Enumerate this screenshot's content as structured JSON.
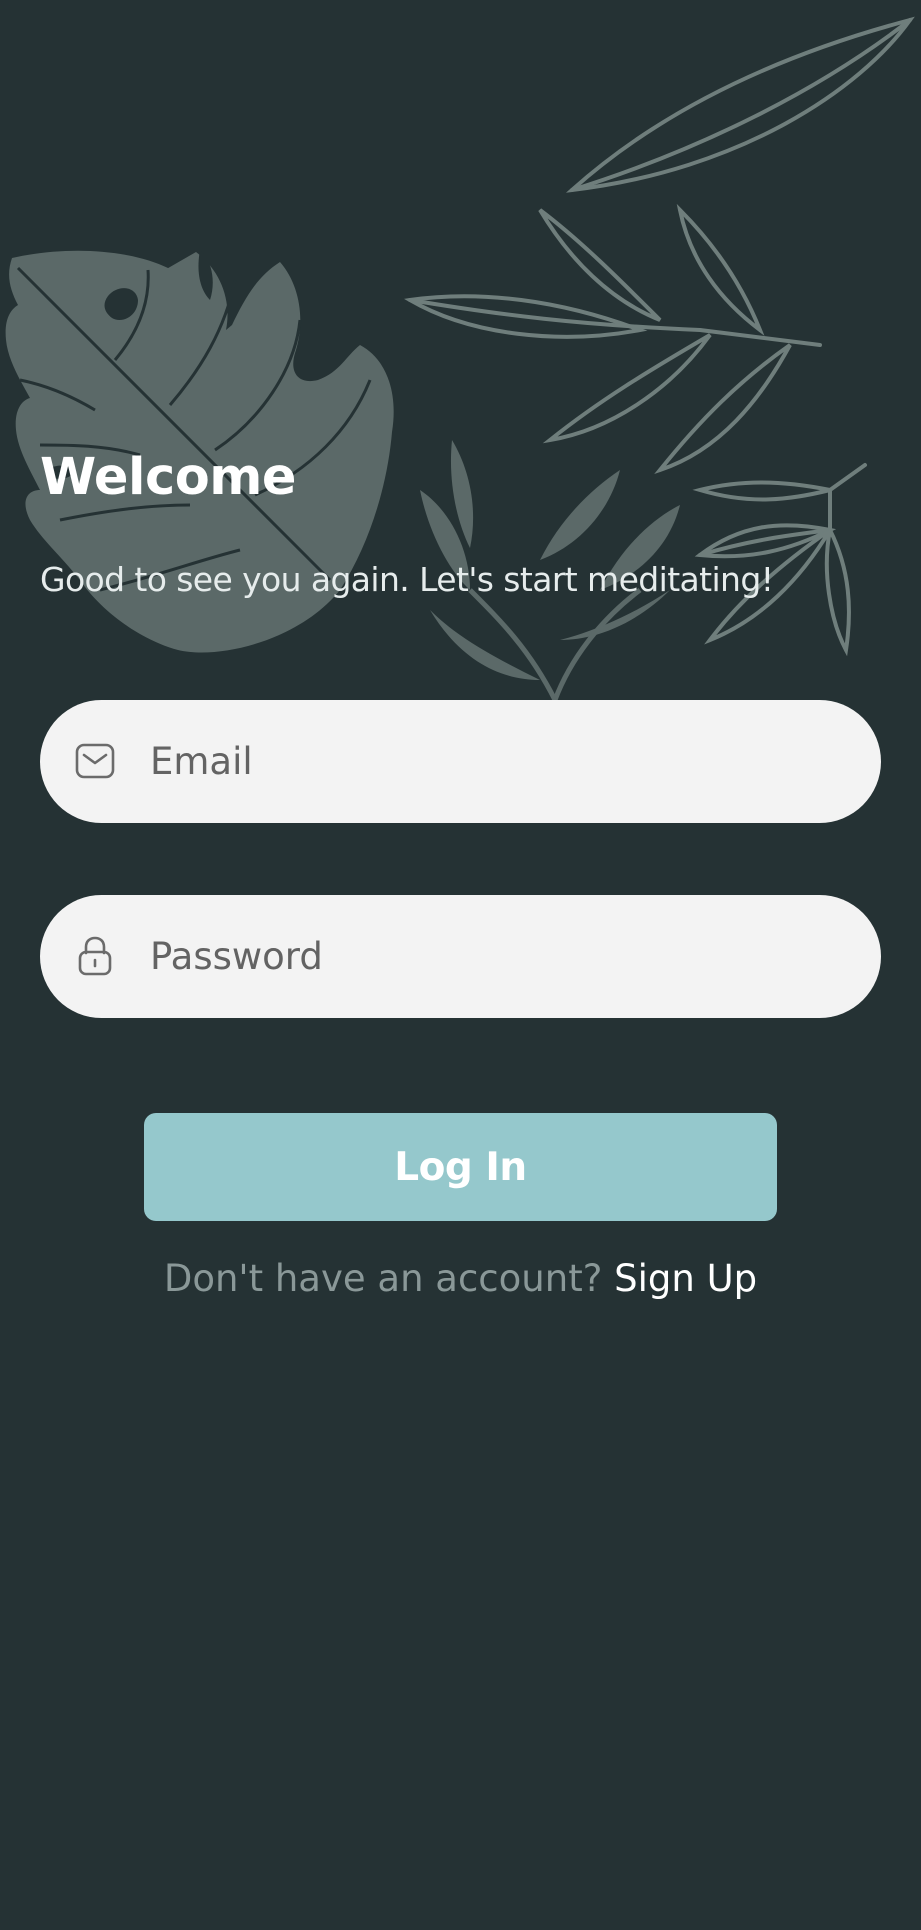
{
  "login": {
    "title": "Welcome",
    "subtitle": "Good to see you again. Let's start meditating!",
    "email_placeholder": "Email",
    "password_placeholder": "Password",
    "login_button": "Log In",
    "signup_prompt": "Don't have an account?",
    "signup_link": "Sign Up"
  },
  "icons": {
    "email": "mail-icon",
    "password": "lock-icon",
    "background": "botanical-leaves-illustration"
  },
  "colors": {
    "background": "#253234",
    "leaf_fill": "#5b6968",
    "leaf_stroke": "#6f7e7c",
    "field_bg": "#f3f3f3",
    "button_bg": "#95c8cc",
    "button_text": "#ffffff",
    "link_text": "#ffffff",
    "prompt_text": "#8a9898"
  }
}
